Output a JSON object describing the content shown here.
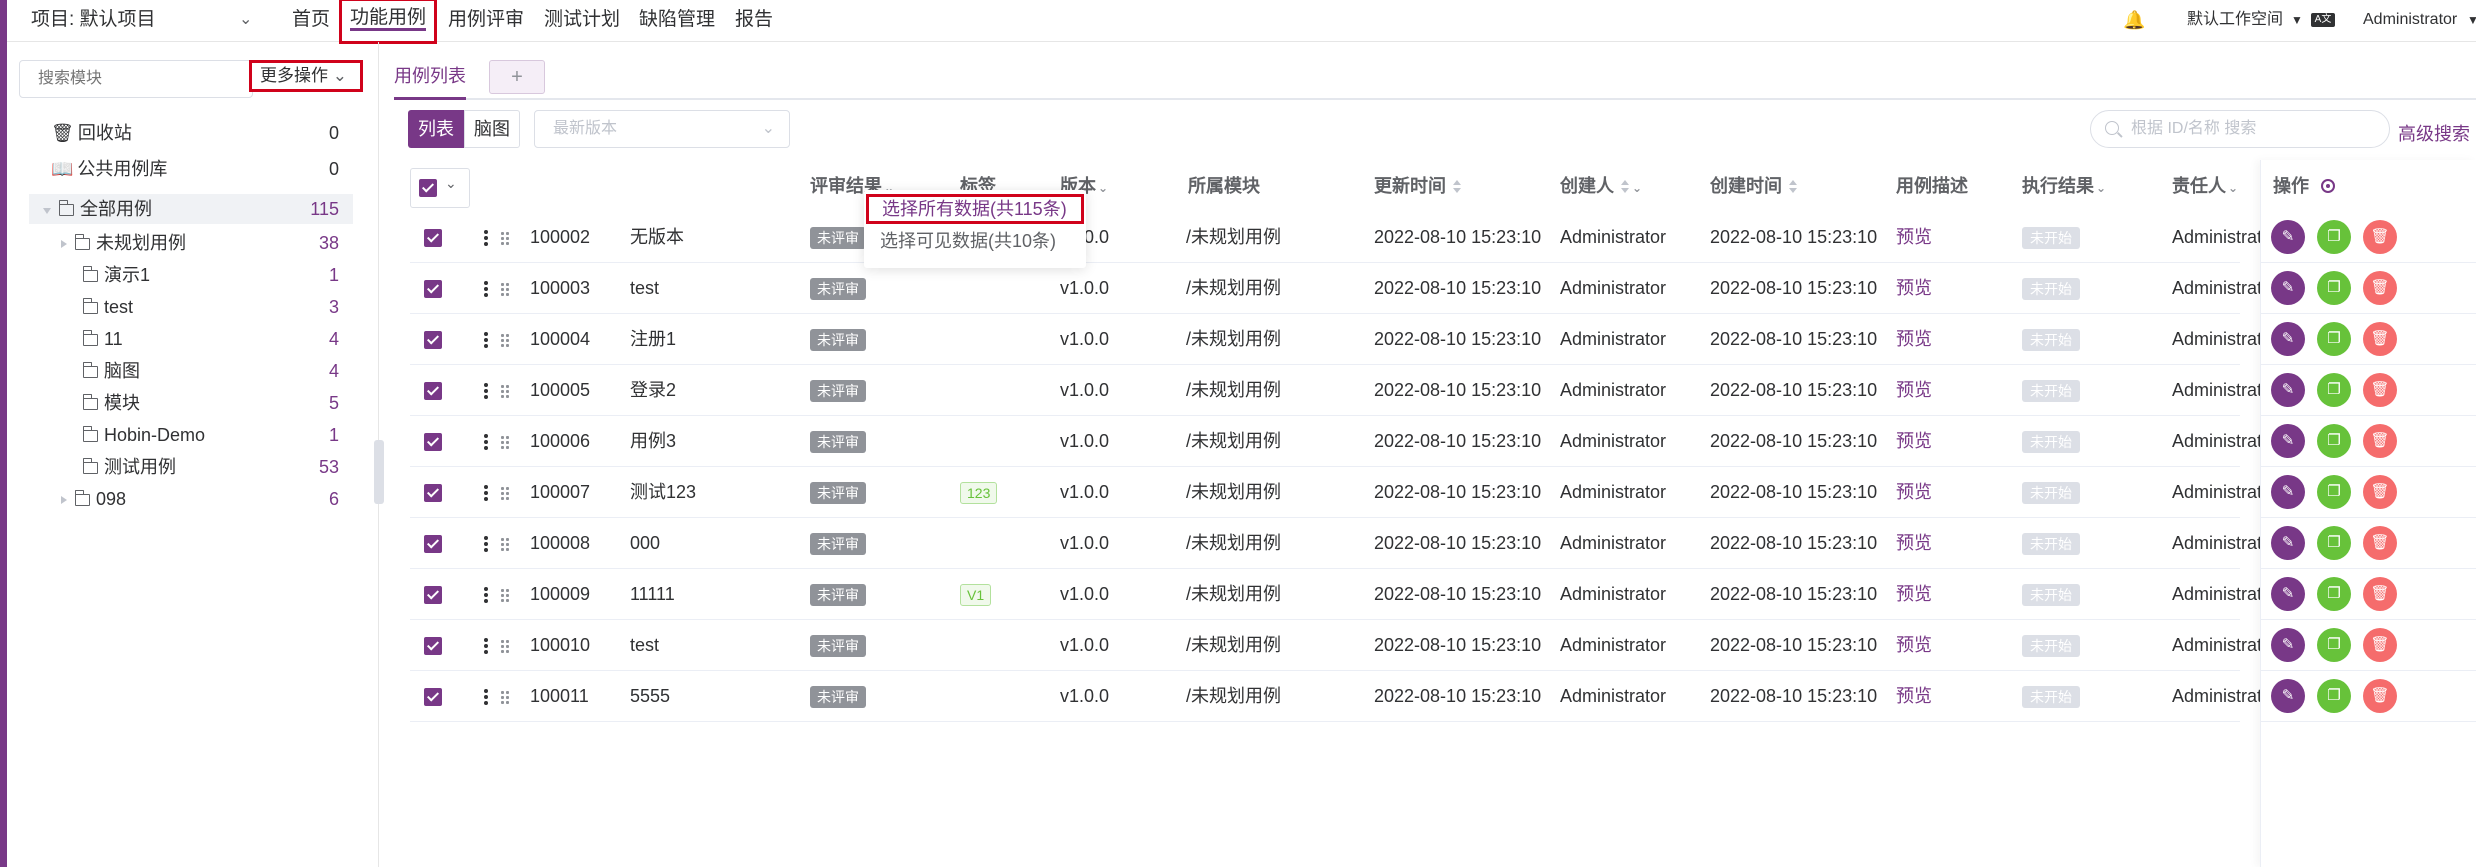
{
  "colors": {
    "accent": "#783887",
    "annotation": "#d0021b",
    "copy": "#67c23a",
    "delete": "#f56c6c"
  },
  "topnav": {
    "project": "项目: 默认项目",
    "menu": [
      "首页",
      "功能用例",
      "用例评审",
      "测试计划",
      "缺陷管理",
      "报告"
    ],
    "active_menu": "功能用例",
    "workspace": "默认工作空间",
    "user": "Administrator",
    "icons": [
      "bell-icon",
      "language-icon",
      "chevron-down-icon"
    ]
  },
  "sidebar": {
    "search_placeholder": "搜索模块",
    "more_ops": "更多操作",
    "trash": {
      "label": "回收站",
      "count": "0"
    },
    "public": {
      "label": "公共用例库",
      "count": "0"
    },
    "root": {
      "label": "全部用例",
      "count": "115"
    },
    "children": [
      {
        "label": "未规划用例",
        "count": "38"
      },
      {
        "label": "演示1",
        "count": "1"
      },
      {
        "label": "test",
        "count": "3"
      },
      {
        "label": "11",
        "count": "4"
      },
      {
        "label": "脑图",
        "count": "4"
      },
      {
        "label": "模块",
        "count": "5"
      },
      {
        "label": "Hobin-Demo",
        "count": "1"
      },
      {
        "label": "测试用例",
        "count": "53"
      },
      {
        "label": "098",
        "count": "6"
      }
    ]
  },
  "main": {
    "tab_label": "用例列表",
    "tab_add": "+",
    "view_list": "列表",
    "view_mind": "脑图",
    "version_placeholder": "最新版本",
    "search_placeholder": "根据 ID/名称 搜索",
    "advanced_search": "高级搜索",
    "columns": [
      "评审结果",
      "标签",
      "版本",
      "所属模块",
      "更新时间",
      "创建人",
      "创建时间",
      "用例描述",
      "执行结果",
      "责任人",
      "操作"
    ],
    "dropdown": [
      "选择所有数据(共115条)",
      "选择可见数据(共10条)"
    ],
    "rows": [
      {
        "id": "100002",
        "name": "无版本",
        "review": "未评审",
        "tag": "",
        "version": "v1.0.0",
        "module": "/未规划用例",
        "updated": "2022-08-10 15:23:10",
        "creator": "Administrator",
        "created": "2022-08-10 15:23:10",
        "desc": "预览",
        "result": "未开始",
        "owner": "Administrator"
      },
      {
        "id": "100003",
        "name": "test",
        "review": "未评审",
        "tag": "",
        "version": "v1.0.0",
        "module": "/未规划用例",
        "updated": "2022-08-10 15:23:10",
        "creator": "Administrator",
        "created": "2022-08-10 15:23:10",
        "desc": "预览",
        "result": "未开始",
        "owner": "Administrator"
      },
      {
        "id": "100004",
        "name": "注册1",
        "review": "未评审",
        "tag": "",
        "version": "v1.0.0",
        "module": "/未规划用例",
        "updated": "2022-08-10 15:23:10",
        "creator": "Administrator",
        "created": "2022-08-10 15:23:10",
        "desc": "预览",
        "result": "未开始",
        "owner": "Administrator"
      },
      {
        "id": "100005",
        "name": "登录2",
        "review": "未评审",
        "tag": "",
        "version": "v1.0.0",
        "module": "/未规划用例",
        "updated": "2022-08-10 15:23:10",
        "creator": "Administrator",
        "created": "2022-08-10 15:23:10",
        "desc": "预览",
        "result": "未开始",
        "owner": "Administrator"
      },
      {
        "id": "100006",
        "name": "用例3",
        "review": "未评审",
        "tag": "",
        "version": "v1.0.0",
        "module": "/未规划用例",
        "updated": "2022-08-10 15:23:10",
        "creator": "Administrator",
        "created": "2022-08-10 15:23:10",
        "desc": "预览",
        "result": "未开始",
        "owner": "Administrator"
      },
      {
        "id": "100007",
        "name": "测试123",
        "review": "未评审",
        "tag": "123",
        "version": "v1.0.0",
        "module": "/未规划用例",
        "updated": "2022-08-10 15:23:10",
        "creator": "Administrator",
        "created": "2022-08-10 15:23:10",
        "desc": "预览",
        "result": "未开始",
        "owner": "Administrator"
      },
      {
        "id": "100008",
        "name": "000",
        "review": "未评审",
        "tag": "",
        "version": "v1.0.0",
        "module": "/未规划用例",
        "updated": "2022-08-10 15:23:10",
        "creator": "Administrator",
        "created": "2022-08-10 15:23:10",
        "desc": "预览",
        "result": "未开始",
        "owner": "Administrator"
      },
      {
        "id": "100009",
        "name": "11111",
        "review": "未评审",
        "tag": "V1",
        "version": "v1.0.0",
        "module": "/未规划用例",
        "updated": "2022-08-10 15:23:10",
        "creator": "Administrator",
        "created": "2022-08-10 15:23:10",
        "desc": "预览",
        "result": "未开始",
        "owner": "Administrator"
      },
      {
        "id": "100010",
        "name": "test",
        "review": "未评审",
        "tag": "",
        "version": "v1.0.0",
        "module": "/未规划用例",
        "updated": "2022-08-10 15:23:10",
        "creator": "Administrator",
        "created": "2022-08-10 15:23:10",
        "desc": "预览",
        "result": "未开始",
        "owner": "Administrator"
      },
      {
        "id": "100011",
        "name": "5555",
        "review": "未评审",
        "tag": "",
        "version": "v1.0.0",
        "module": "/未规划用例",
        "updated": "2022-08-10 15:23:10",
        "creator": "Administrator",
        "created": "2022-08-10 15:23:10",
        "desc": "预览",
        "result": "未开始",
        "owner": "Administrator"
      }
    ]
  }
}
